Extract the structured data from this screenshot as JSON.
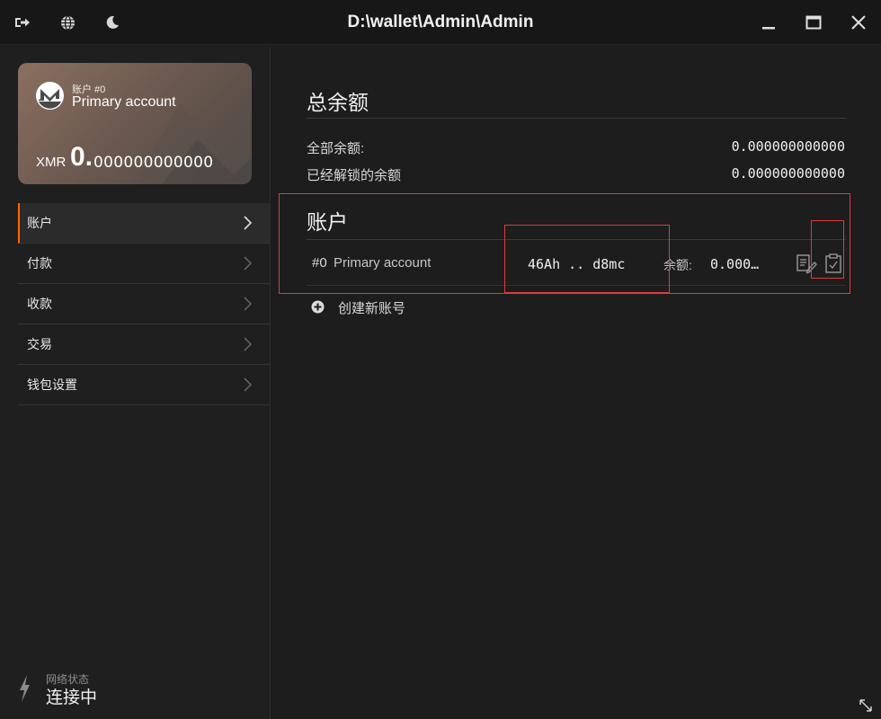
{
  "window": {
    "title": "D:\\wallet\\Admin\\Admin"
  },
  "titlebar": {
    "icons": [
      "logout-icon",
      "globe-icon",
      "moon-icon"
    ],
    "controls": [
      "minimize-icon",
      "maximize-icon",
      "close-icon"
    ]
  },
  "card": {
    "account_label": "账户 #0",
    "account_name": "Primary account",
    "currency": "XMR",
    "balance_int": "0.",
    "balance_dec": "000000000000"
  },
  "nav": {
    "items": [
      {
        "label": "账户",
        "active": true
      },
      {
        "label": "付款",
        "active": false
      },
      {
        "label": "收款",
        "active": false
      },
      {
        "label": "交易",
        "active": false
      },
      {
        "label": "钱包设置",
        "active": false
      }
    ]
  },
  "network": {
    "label": "网络状态",
    "value": "连接中"
  },
  "balance": {
    "heading": "总余额",
    "total_label": "全部余额:",
    "total_value": "0.000000000000",
    "unlocked_label": "已经解锁的余额",
    "unlocked_value": "0.000000000000"
  },
  "accounts": {
    "heading": "账户",
    "rows": [
      {
        "index": "#0",
        "name": "Primary account",
        "address": "46Ah .. d8mc",
        "balance_label": "余额:",
        "balance_value": "0.000…"
      }
    ],
    "create_label": "创建新账号"
  },
  "colors": {
    "accent": "#ff6600",
    "highlight": "#e23a3a"
  }
}
